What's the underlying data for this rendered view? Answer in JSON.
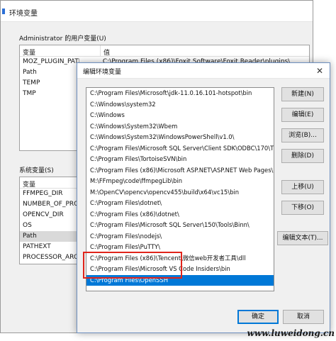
{
  "bg_window": {
    "title": "环境变量",
    "side_text": "",
    "user_group_label": "Administrator 的用户变量(U)",
    "user_columns": [
      "变量",
      "值"
    ],
    "user_vars": [
      {
        "name": "MOZ_PLUGIN_PATH",
        "value": "C:\\Program Files (x86)\\Foxit Software\\Foxit Reader\\plugins\\"
      },
      {
        "name": "Path",
        "value": ""
      },
      {
        "name": "TEMP",
        "value": ""
      },
      {
        "name": "TMP",
        "value": ""
      }
    ],
    "system_group_label": "系统变量(S)",
    "system_columns": [
      "变量"
    ],
    "system_vars": [
      {
        "name": "FFMPEG_DIR"
      },
      {
        "name": "NUMBER_OF_PROCESSORS"
      },
      {
        "name": "OPENCV_DIR"
      },
      {
        "name": "OS"
      },
      {
        "name": "Path"
      },
      {
        "name": "PATHEXT"
      },
      {
        "name": "PROCESSOR_ARCHITECTURE"
      }
    ]
  },
  "dialog": {
    "title": "编辑环境变量",
    "close_glyph": "✕",
    "paths": [
      "C:\\Program Files\\Microsoft\\jdk-11.0.16.101-hotspot\\bin",
      "C:\\Windows\\system32",
      "C:\\Windows",
      "C:\\Windows\\System32\\Wbem",
      "C:\\Windows\\System32\\WindowsPowerShell\\v1.0\\",
      "C:\\Program Files\\Microsoft SQL Server\\Client SDK\\ODBC\\170\\T...",
      "C:\\Program Files\\TortoiseSVN\\bin",
      "C:\\Program Files (x86)\\Microsoft ASP.NET\\ASP.NET Web Pages\\...",
      "M:\\FFmpeg\\code\\ffmpegLib\\bin",
      "M:\\OpenCV\\opencv\\opencv455\\build\\x64\\vc15\\bin",
      "C:\\Program Files\\dotnet\\",
      "C:\\Program Files (x86)\\dotnet\\",
      "C:\\Program Files\\Microsoft SQL Server\\150\\Tools\\Binn\\",
      "C:\\Program Files\\nodejs\\",
      "C:\\Program Files\\PuTTY\\",
      "C:\\Program Files (x86)\\Tencent\\微信web开发者工具\\dll",
      "C:\\Program Files\\Microsoft VS Code Insiders\\bin",
      "C:\\Program Files\\OpenSSH"
    ],
    "selected_index": 17,
    "buttons": {
      "new": "新建(N)",
      "edit": "编辑(E)",
      "browse": "浏览(B)...",
      "delete": "删除(D)",
      "move_up": "上移(U)",
      "move_down": "下移(O)",
      "edit_text": "编辑文本(T)...",
      "ok": "确定",
      "cancel": "取消"
    }
  },
  "colors": {
    "selection": "#0078d7",
    "highlight_box": "#e0241b"
  },
  "watermark": "www.luweidong.cn"
}
